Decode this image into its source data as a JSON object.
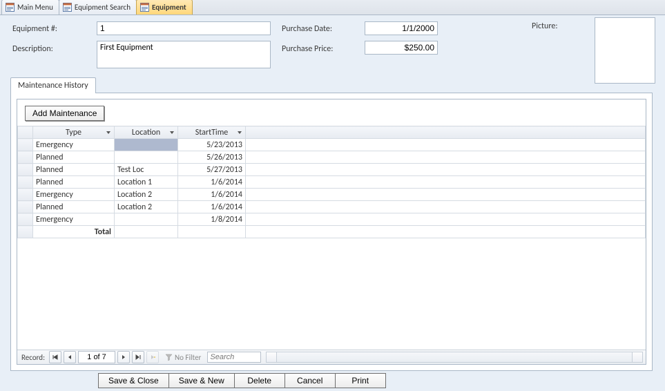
{
  "tabs": [
    {
      "label": "Main Menu",
      "active": false
    },
    {
      "label": "Equipment Search",
      "active": false
    },
    {
      "label": "Equipment",
      "active": true
    }
  ],
  "form": {
    "equip_label": "Equipment #:",
    "equip_value": "1",
    "desc_label": "Description:",
    "desc_value": "First Equipment",
    "pdate_label": "Purchase Date:",
    "pdate_value": "1/1/2000",
    "pprice_label": "Purchase Price:",
    "pprice_value": "$250.00",
    "picture_label": "Picture:"
  },
  "subform": {
    "tab_label": "Maintenance History",
    "add_button": "Add Maintenance",
    "columns": {
      "type": "Type",
      "location": "Location",
      "start": "StartTime"
    },
    "rows": [
      {
        "type": "Emergency",
        "location": "",
        "start": "5/23/2013",
        "selected": true
      },
      {
        "type": "Planned",
        "location": "",
        "start": "5/26/2013"
      },
      {
        "type": "Planned",
        "location": "Test Loc",
        "start": "5/27/2013"
      },
      {
        "type": "Planned",
        "location": "Location 1",
        "start": "1/6/2014"
      },
      {
        "type": "Emergency",
        "location": "Location 2",
        "start": "1/6/2014"
      },
      {
        "type": "Planned",
        "location": "Location 2",
        "start": "1/6/2014"
      },
      {
        "type": "Emergency",
        "location": "",
        "start": "1/8/2014"
      }
    ],
    "total_label": "Total"
  },
  "recnav": {
    "label": "Record:",
    "position": "1 of 7",
    "filter_label": "No Filter",
    "search_placeholder": "Search"
  },
  "actions": {
    "save_close": "Save & Close",
    "save_new": "Save & New",
    "delete": "Delete",
    "cancel": "Cancel",
    "print": "Print"
  }
}
